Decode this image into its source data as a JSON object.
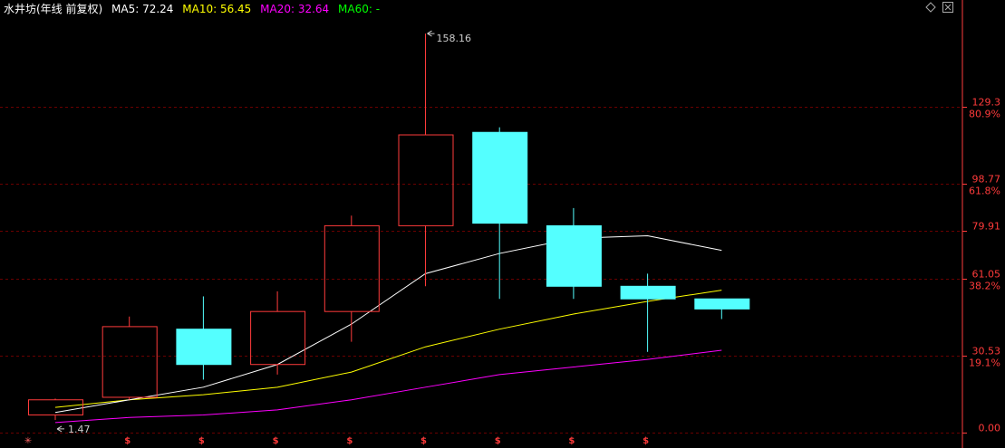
{
  "header": {
    "title": "水井坊(年线 前复权)",
    "ma5": "MA5: 72.24",
    "ma10": "MA10: 56.45",
    "ma20": "MA20: 32.64",
    "ma60": "MA60: -"
  },
  "colors": {
    "up": "#ff3b3b",
    "down": "#54ffff",
    "ma5": "#ffffff",
    "ma10": "#ffff00",
    "ma20": "#ff00ff",
    "ma60": "#00ff00",
    "axis_text": "#ff3b3b",
    "gold_text": "#ffbf00",
    "grid": "#6a0000",
    "title_text": "#ffffff"
  },
  "chart_data": {
    "type": "candlestick",
    "ylim": [
      0,
      165
    ],
    "y_ticks": [
      {
        "value": 129.3,
        "label": "129.3",
        "pct": "80.9%"
      },
      {
        "value": 98.77,
        "label": "98.77",
        "pct": "61.8%"
      },
      {
        "value": 79.91,
        "label": "79.91",
        "pct": ""
      },
      {
        "value": 61.05,
        "label": "61.05",
        "pct": "38.2%"
      },
      {
        "value": 30.53,
        "label": "30.53",
        "pct": "19.1%"
      },
      {
        "value": 0.0,
        "label": "0.00",
        "pct": ""
      }
    ],
    "candles": [
      {
        "open": 7,
        "close": 13,
        "high": 13.5,
        "low": 5
      },
      {
        "open": 14,
        "close": 42,
        "high": 46,
        "low": 13
      },
      {
        "open": 41,
        "close": 27,
        "high": 54,
        "low": 21
      },
      {
        "open": 27,
        "close": 48,
        "high": 56,
        "low": 23
      },
      {
        "open": 48,
        "close": 82,
        "high": 86,
        "low": 36
      },
      {
        "open": 82,
        "close": 118,
        "high": 158.16,
        "low": 58
      },
      {
        "open": 119,
        "close": 83,
        "high": 121,
        "low": 53
      },
      {
        "open": 82,
        "close": 58,
        "high": 89,
        "low": 53
      },
      {
        "open": 58,
        "close": 53,
        "high": 63,
        "low": 32
      },
      {
        "open": 53,
        "close": 49,
        "high": 53,
        "low": 45
      }
    ],
    "ma5": [
      8,
      13,
      18,
      27,
      43,
      63,
      71,
      77,
      78,
      72.24
    ],
    "ma10": [
      10,
      13,
      15,
      18,
      24,
      34,
      41,
      47,
      52,
      56.45
    ],
    "ma20": [
      4,
      6,
      7,
      9,
      13,
      18,
      23,
      26,
      29,
      32.64
    ],
    "annotations": {
      "max_label": "158.16",
      "min_label": "1.47",
      "min_value": 1.47,
      "max_index": 5,
      "min_index": 0
    },
    "dividend_marker": "$",
    "dividend_indices": [
      1,
      2,
      3,
      4,
      5,
      6,
      7,
      8
    ]
  }
}
